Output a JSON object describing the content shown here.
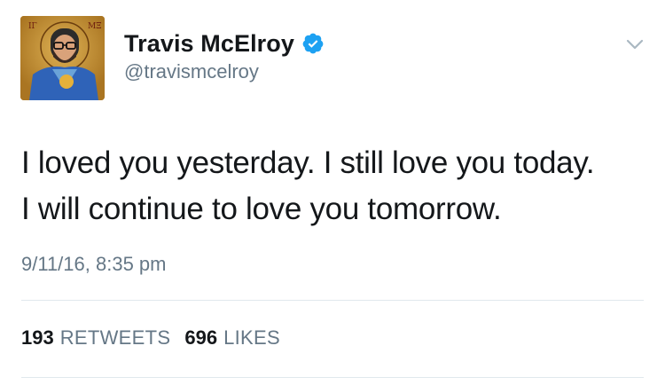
{
  "tweet": {
    "author": {
      "display_name": "Travis McElroy",
      "handle": "@travismcelroy",
      "verified": true
    },
    "text": "I loved you yesterday. I still love you today.\nI will continue to love you tomorrow.",
    "timestamp": "9/11/16, 8:35 pm",
    "stats": {
      "retweets_count": "193",
      "retweets_label": "RETWEETS",
      "likes_count": "696",
      "likes_label": "LIKES"
    }
  },
  "colors": {
    "text_primary": "#14171a",
    "text_secondary": "#657786",
    "verified_blue": "#1da1f2",
    "divider": "#e1e8ed",
    "avatar_gold": "#c58a2c"
  },
  "icons": {
    "verified": "verified-badge-icon",
    "menu": "chevron-down-icon"
  }
}
